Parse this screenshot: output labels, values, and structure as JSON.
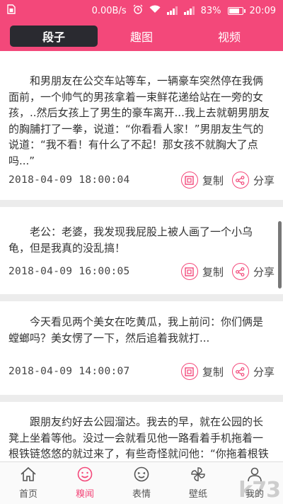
{
  "status_bar": {
    "speed": "0.00B/s",
    "battery_percent": "83%",
    "battery_level": 0.83,
    "time": "20:09",
    "icons": [
      "sim-icon",
      "speed-icon",
      "alarm-icon",
      "wifi-icon",
      "signal-icon",
      "battery-icon"
    ]
  },
  "tabs": [
    {
      "label": "段子",
      "active": true
    },
    {
      "label": "趣图",
      "active": false
    },
    {
      "label": "视频",
      "active": false
    }
  ],
  "posts": [
    {
      "text": "和男朋友在公交车站等车，一辆豪车突然停在我俩面前，一个帅气的男孩拿着一束鲜花递给站在一旁的女孩，..然后女孩上了男生的豪车离开...我上去就朝男朋友的胸脯打了一拳，说道：“你看看人家！”男朋友生气的说道：“我不看！有什么了不起！那女孩不就胸大了点吗...”",
      "time": "2018-04-09 18:00:04",
      "copy_label": "复制",
      "share_label": "分享"
    },
    {
      "text": "老公：老婆，我发现我屁股上被人画了一个小乌龟，但是我真的没乱搞！",
      "time": "2018-04-09 16:00:05",
      "copy_label": "复制",
      "share_label": "分享"
    },
    {
      "text": "今天看见两个美女在吃黄瓜，我上前问：你们俩是螳螂吗？美女愣了一下，然后追着我就打...",
      "time": "2018-04-09 14:00:07",
      "copy_label": "复制",
      "share_label": "分享"
    },
    {
      "text": "跟朋友约好去公园溜达。我去的早，就在公园的长凳上坐着等他。没过一会就看见他一路看着手机拖着一根铁链悠悠的就过来了，有些奇怪就问他：“你拖着根铁链干啥？”",
      "time": "",
      "copy_label": "",
      "share_label": ""
    }
  ],
  "bottom_nav": [
    {
      "label": "首页",
      "icon": "home-icon",
      "active": false
    },
    {
      "label": "糗闻",
      "icon": "smiley-icon",
      "active": true
    },
    {
      "label": "表情",
      "icon": "emoji-icon",
      "active": false
    },
    {
      "label": "壁纸",
      "icon": "pinwheel-icon",
      "active": false
    },
    {
      "label": "我的",
      "icon": "user-icon",
      "active": false
    }
  ],
  "watermark": "k73",
  "colors": {
    "accent": "#f3487a",
    "active_tab": "#2a2a30"
  }
}
